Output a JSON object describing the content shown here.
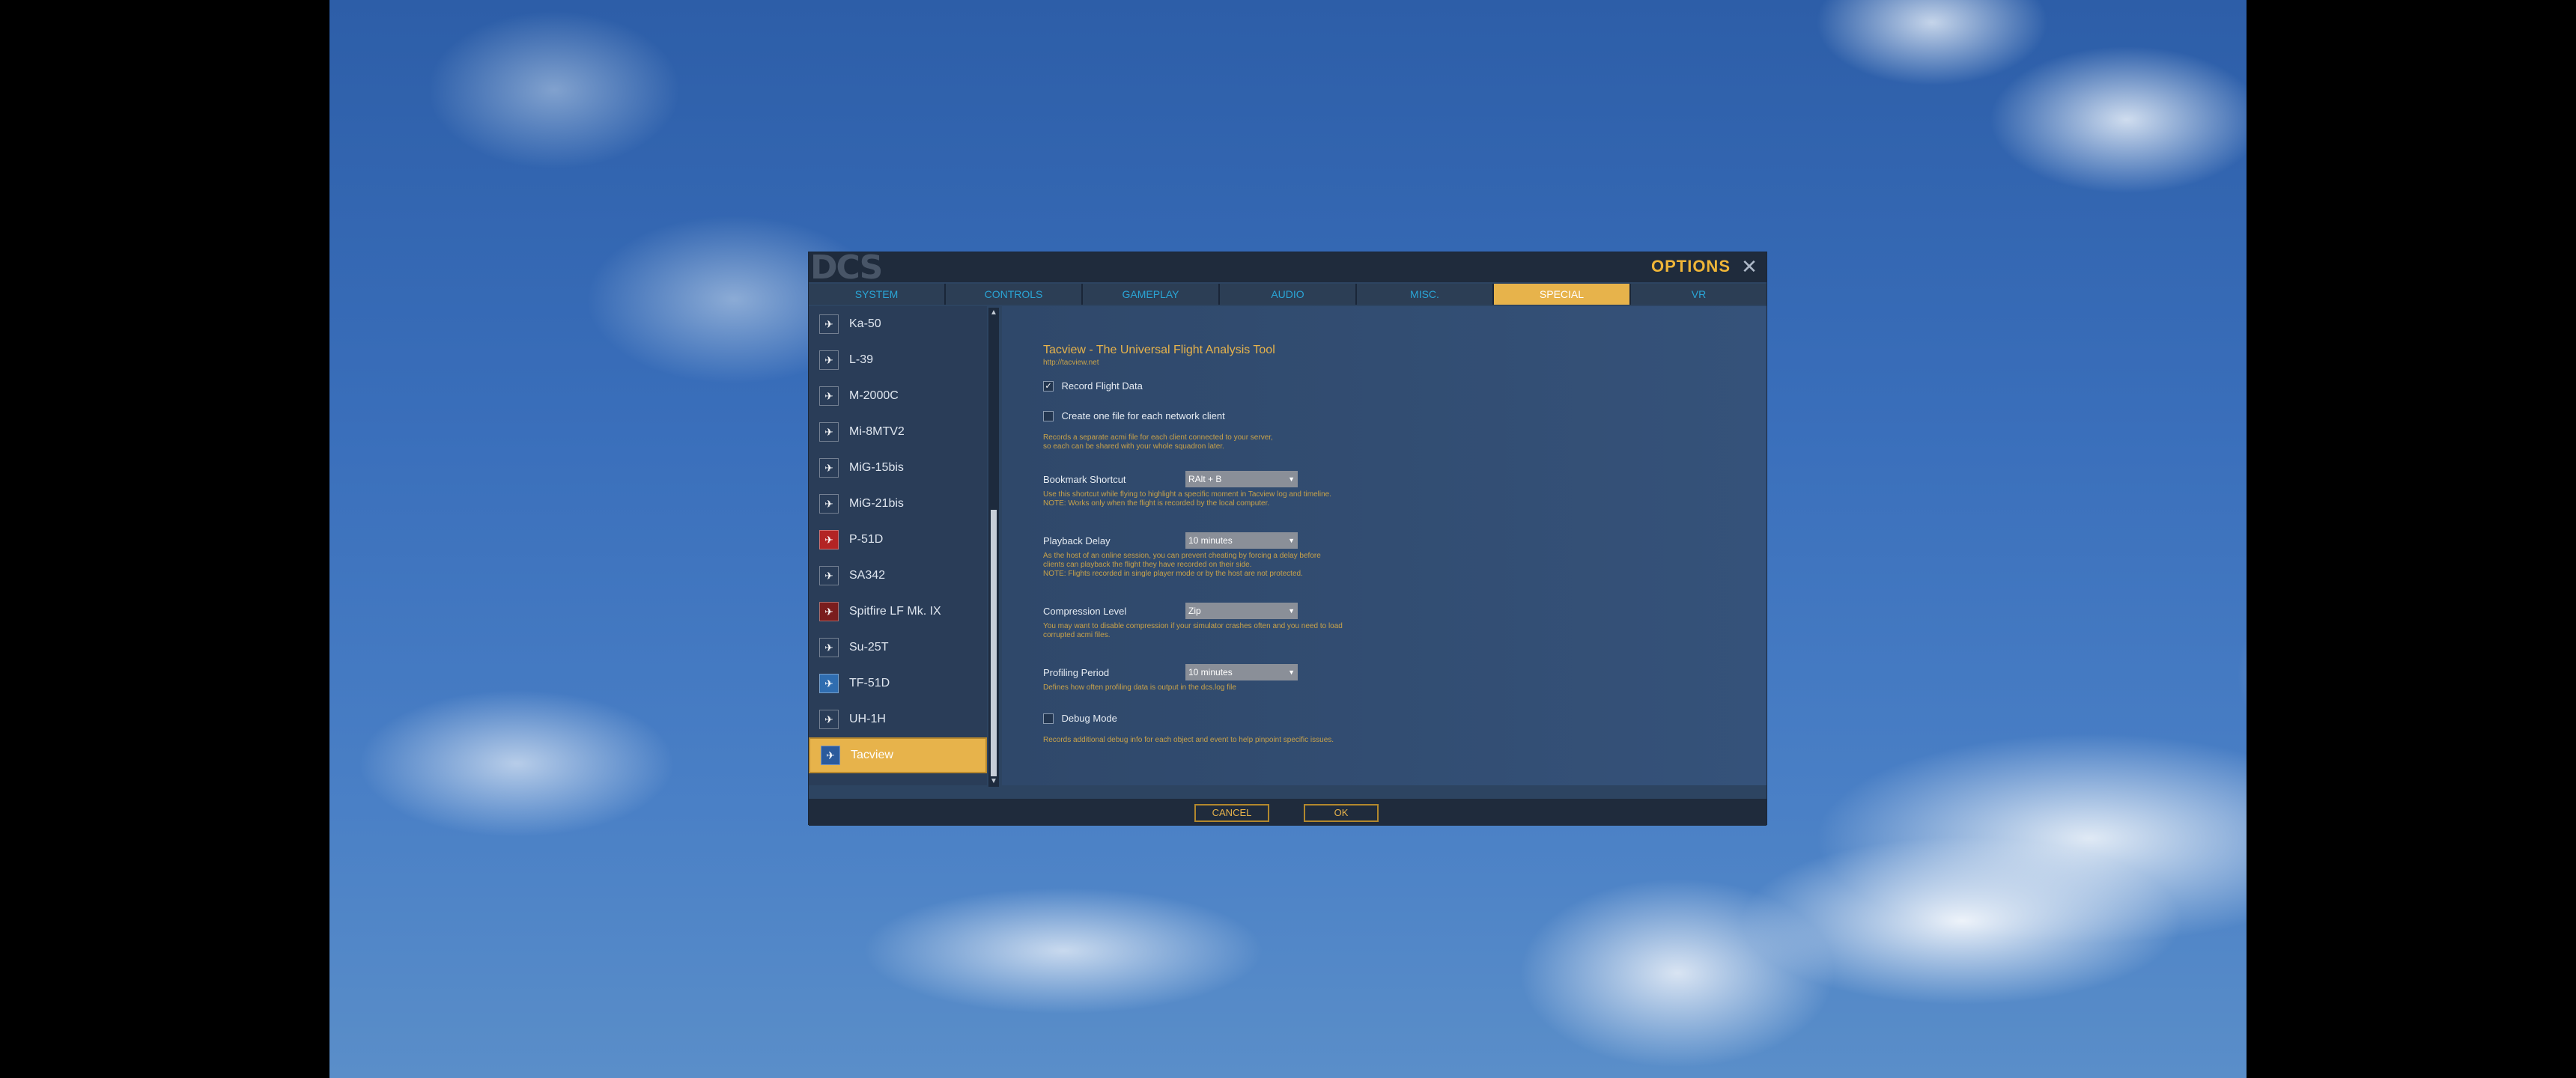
{
  "window": {
    "title": "OPTIONS",
    "logo": "DCS",
    "close_icon": "close-icon"
  },
  "tabs": [
    {
      "label": "SYSTEM"
    },
    {
      "label": "CONTROLS"
    },
    {
      "label": "GAMEPLAY"
    },
    {
      "label": "AUDIO"
    },
    {
      "label": "MISC."
    },
    {
      "label": "SPECIAL",
      "active": true
    },
    {
      "label": "VR"
    }
  ],
  "sidebar": {
    "items": [
      {
        "label": "Ka-50",
        "icon": "helicopter-icon"
      },
      {
        "label": "L-39",
        "icon": "jet-icon"
      },
      {
        "label": "M-2000C",
        "icon": "jet-icon"
      },
      {
        "label": "Mi-8MTV2",
        "icon": "helicopter-icon"
      },
      {
        "label": "MiG-15bis",
        "icon": "jet-icon"
      },
      {
        "label": "MiG-21bis",
        "icon": "jet-icon"
      },
      {
        "label": "P-51D",
        "icon": "prop-plane-icon"
      },
      {
        "label": "SA342",
        "icon": "helicopter-icon"
      },
      {
        "label": "Spitfire LF Mk. IX",
        "icon": "prop-plane-icon"
      },
      {
        "label": "Su-25T",
        "icon": "jet-icon"
      },
      {
        "label": "TF-51D",
        "icon": "prop-plane-icon"
      },
      {
        "label": "UH-1H",
        "icon": "helicopter-icon"
      },
      {
        "label": "Tacview",
        "icon": "tacview-icon",
        "active": true
      }
    ]
  },
  "tacview": {
    "title": "Tacview - The Universal Flight Analysis Tool",
    "url": "http://tacview.net",
    "record_flight_data": {
      "label": "Record Flight Data",
      "checked": true
    },
    "one_file_per_client": {
      "label": "Create one file for each network client",
      "checked": false,
      "desc1": "Records a separate acmi file for each client connected to your server,",
      "desc2": "so each can be shared with your whole squadron later."
    },
    "bookmark": {
      "label": "Bookmark Shortcut",
      "value": "RAlt + B",
      "desc1": "Use this shortcut while flying to highlight a specific moment in Tacview log and timeline.",
      "desc2": "NOTE: Works only when the flight is recorded by the local computer."
    },
    "playback_delay": {
      "label": "Playback Delay",
      "value": "10 minutes",
      "desc1": "As the host of an online session, you can prevent cheating by forcing a delay before",
      "desc2": "clients can playback the flight they have recorded on their side.",
      "desc3": "NOTE: Flights recorded in single player mode or by the host are not protected."
    },
    "compression": {
      "label": "Compression Level",
      "value": "Zip",
      "desc1": "You may want to disable compression if your simulator crashes often and you need to load",
      "desc2": "corrupted acmi files."
    },
    "profiling": {
      "label": "Profiling Period",
      "value": "10 minutes",
      "desc1": "Defines how often profiling data is output in the dcs.log file"
    },
    "debug": {
      "label": "Debug Mode",
      "checked": false,
      "desc1": "Records additional debug info for each object and event to help pinpoint specific issues."
    }
  },
  "footer": {
    "cancel": "CANCEL",
    "ok": "OK"
  },
  "colors": {
    "accent": "#e7b34b",
    "tab_text": "#2aa5d6",
    "panel": "#2d4461"
  }
}
